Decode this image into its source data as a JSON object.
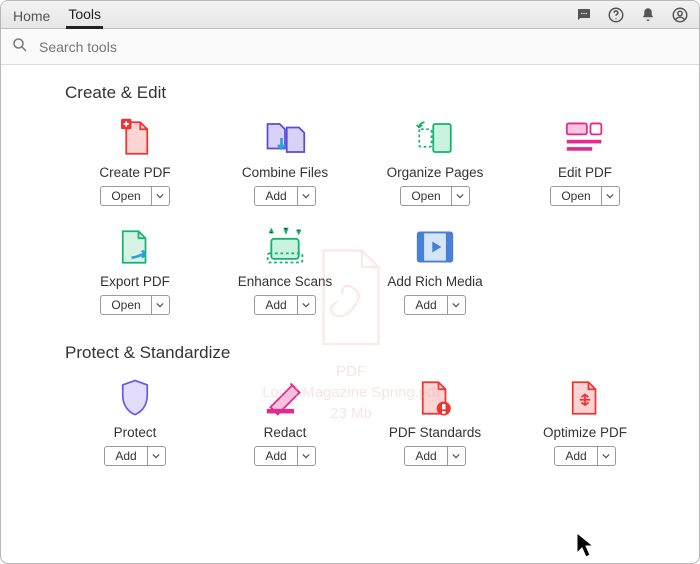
{
  "tabs": {
    "home": "Home",
    "tools": "Tools"
  },
  "search": {
    "placeholder": "Search tools"
  },
  "sections": {
    "create_edit": "Create & Edit",
    "protect_std": "Protect & Standardize"
  },
  "buttons": {
    "open": "Open",
    "add": "Add"
  },
  "tools": {
    "create_pdf": {
      "label": "Create PDF",
      "action": "open"
    },
    "combine_files": {
      "label": "Combine Files",
      "action": "add"
    },
    "organize_pages": {
      "label": "Organize Pages",
      "action": "open"
    },
    "edit_pdf": {
      "label": "Edit PDF",
      "action": "open"
    },
    "export_pdf": {
      "label": "Export PDF",
      "action": "open"
    },
    "enhance_scans": {
      "label": "Enhance Scans",
      "action": "add"
    },
    "add_rich_media": {
      "label": "Add Rich Media",
      "action": "add"
    },
    "protect": {
      "label": "Protect",
      "action": "add"
    },
    "redact": {
      "label": "Redact",
      "action": "add"
    },
    "pdf_standards": {
      "label": "PDF Standards",
      "action": "add"
    },
    "optimize_pdf": {
      "label": "Optimize PDF",
      "action": "add"
    }
  },
  "ghost": {
    "type": "PDF",
    "name": "Local Magazine Spring.pdf",
    "size": "23 Mb"
  }
}
